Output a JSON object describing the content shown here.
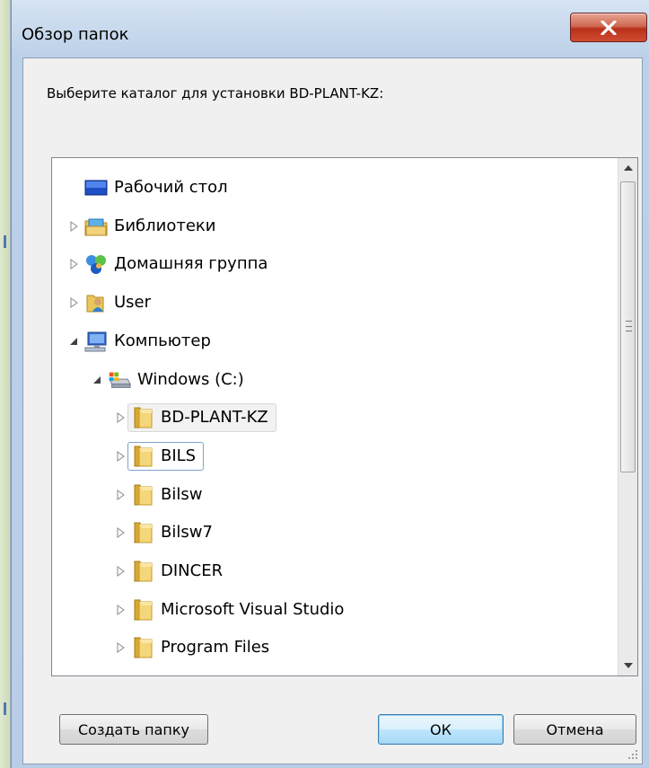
{
  "window": {
    "title": "Обзор папок",
    "prompt": "Выберите каталог для установки BD-PLANT-KZ:"
  },
  "tree": {
    "items": [
      {
        "label": "Рабочий стол",
        "icon": "desktop-icon",
        "expander": "none",
        "level": 0
      },
      {
        "label": "Библиотеки",
        "icon": "libraries-icon",
        "expander": "collapsed",
        "level": 0
      },
      {
        "label": "Домашняя группа",
        "icon": "homegroup-icon",
        "expander": "collapsed",
        "level": 0
      },
      {
        "label": "User",
        "icon": "user-folder-icon",
        "expander": "collapsed",
        "level": 0
      },
      {
        "label": "Компьютер",
        "icon": "computer-icon",
        "expander": "expanded",
        "level": 0
      },
      {
        "label": "Windows (C:)",
        "icon": "drive-icon",
        "expander": "expanded",
        "level": 1
      },
      {
        "label": "BD-PLANT-KZ",
        "icon": "folder-icon",
        "expander": "collapsed",
        "level": 2,
        "state": "hover"
      },
      {
        "label": "BILS",
        "icon": "folder-icon",
        "expander": "collapsed",
        "level": 2,
        "state": "selected"
      },
      {
        "label": "Bilsw",
        "icon": "folder-icon",
        "expander": "collapsed",
        "level": 2
      },
      {
        "label": "Bilsw7",
        "icon": "folder-icon",
        "expander": "collapsed",
        "level": 2
      },
      {
        "label": "DINCER",
        "icon": "folder-icon",
        "expander": "collapsed",
        "level": 2
      },
      {
        "label": "Microsoft Visual Studio",
        "icon": "folder-icon",
        "expander": "collapsed",
        "level": 2
      },
      {
        "label": "Program Files",
        "icon": "folder-icon",
        "expander": "collapsed",
        "level": 2
      }
    ]
  },
  "buttons": {
    "new_folder": "Создать папку",
    "ok": "ОК",
    "cancel": "Отмена"
  },
  "colors": {
    "close_button": "#c7432a",
    "selection_border": "#7da2ce",
    "folder": "#e8c75a"
  }
}
